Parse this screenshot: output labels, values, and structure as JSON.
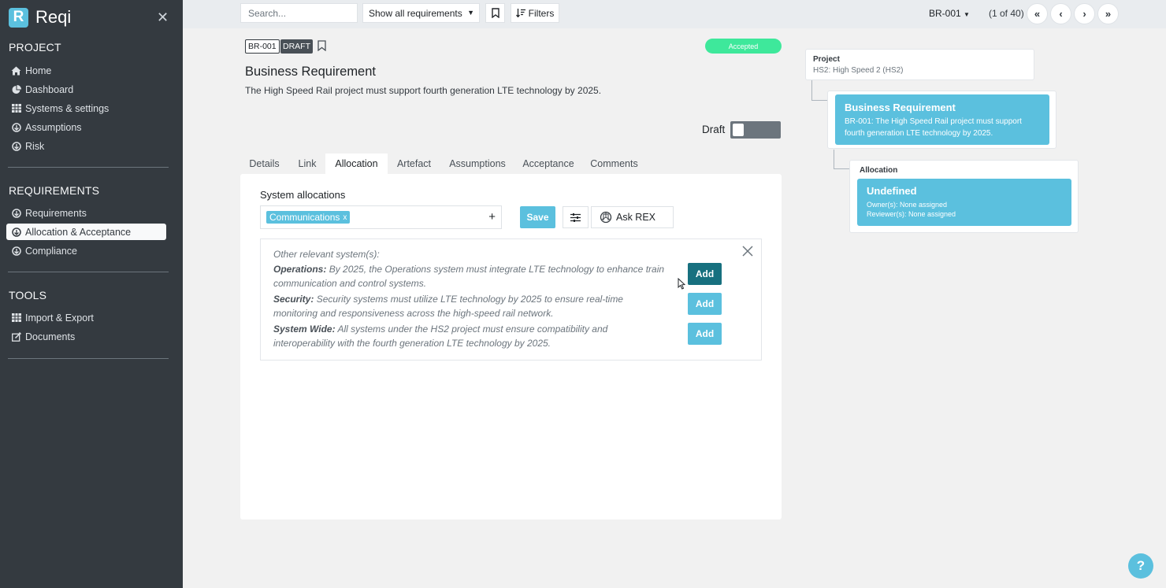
{
  "app": {
    "logo_letter": "R",
    "name": "Reqi"
  },
  "sidebar": {
    "sections": [
      {
        "title": "PROJECT",
        "items": [
          {
            "label": "Home",
            "icon": "home-icon"
          },
          {
            "label": "Dashboard",
            "icon": "pie-chart-icon"
          },
          {
            "label": "Systems & settings",
            "icon": "grid-icon"
          },
          {
            "label": "Assumptions",
            "icon": "circle-arrow-icon"
          },
          {
            "label": "Risk",
            "icon": "circle-arrow-icon"
          }
        ]
      },
      {
        "title": "REQUIREMENTS",
        "items": [
          {
            "label": "Requirements",
            "icon": "circle-arrow-icon"
          },
          {
            "label": "Allocation & Acceptance",
            "icon": "circle-arrow-icon",
            "active": true
          },
          {
            "label": "Compliance",
            "icon": "circle-arrow-icon"
          }
        ]
      },
      {
        "title": "TOOLS",
        "items": [
          {
            "label": "Import & Export",
            "icon": "grid-icon"
          },
          {
            "label": "Documents",
            "icon": "edit-icon"
          }
        ]
      }
    ]
  },
  "topbar": {
    "search_placeholder": "Search...",
    "filter_select": "Show all requirements",
    "filters_label": "Filters",
    "current_id": "BR-001",
    "counter": "(1 of 40)"
  },
  "requirement": {
    "id": "BR-001",
    "status_badge": "DRAFT",
    "acceptance_status": "Accepted",
    "title": "Business Requirement",
    "description": "The High Speed Rail project must support fourth generation LTE technology by 2025.",
    "draft_label": "Draft"
  },
  "tabs": [
    "Details",
    "Link",
    "Allocation",
    "Artefact",
    "Assumptions",
    "Acceptance",
    "Comments"
  ],
  "active_tab": "Allocation",
  "allocation": {
    "label": "System allocations",
    "tags": [
      "Communications"
    ],
    "tag_remove": "x",
    "save_label": "Save",
    "ask_label": "Ask REX",
    "suggestions_title": "Other relevant system(s):",
    "add_label": "Add",
    "suggestions": [
      {
        "system": "Operations:",
        "text": "By 2025, the Operations system must integrate LTE technology to enhance train communication and control systems."
      },
      {
        "system": "Security:",
        "text": "Security systems must utilize LTE technology by 2025 to ensure real-time monitoring and responsiveness across the high-speed rail network."
      },
      {
        "system": "System Wide:",
        "text": "All systems under the HS2 project must ensure compatibility and interoperability with the fourth generation LTE technology by 2025."
      }
    ]
  },
  "tree": {
    "project_label": "Project",
    "project_value": "HS2: High Speed 2 (HS2)",
    "requirement_title": "Business Requirement",
    "requirement_text": "BR-001: The High Speed Rail project must support fourth generation LTE technology by 2025.",
    "allocation_label": "Allocation",
    "allocation_title": "Undefined",
    "owner": "Owner(s): None assigned",
    "reviewer": "Reviewer(s): None assigned"
  },
  "help_label": "?",
  "colors": {
    "sidebar": "#343a40",
    "accent": "#5bc0de",
    "accepted": "#3ee89b",
    "add_active": "#17707f"
  }
}
